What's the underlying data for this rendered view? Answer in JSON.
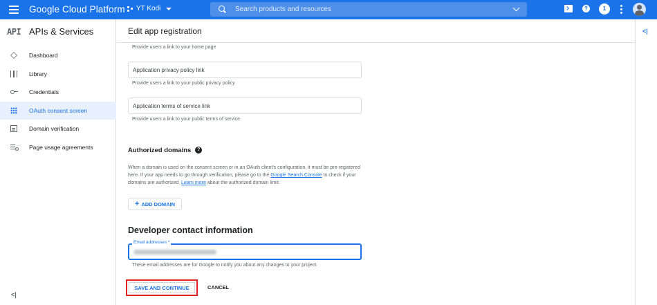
{
  "topbar": {
    "brand": "Google Cloud Platform",
    "project": "YT Kodi",
    "search_placeholder": "Search products and resources",
    "notifications_count": "1"
  },
  "sidebar": {
    "logo": "API",
    "title": "APIs & Services",
    "items": [
      {
        "label": "Dashboard",
        "icon": "dashboard-icon",
        "active": false
      },
      {
        "label": "Library",
        "icon": "library-icon",
        "active": false
      },
      {
        "label": "Credentials",
        "icon": "key-icon",
        "active": false
      },
      {
        "label": "OAuth consent screen",
        "icon": "oauth-icon",
        "active": true
      },
      {
        "label": "Domain verification",
        "icon": "domain-icon",
        "active": false
      },
      {
        "label": "Page usage agreements",
        "icon": "page-usage-icon",
        "active": false
      }
    ],
    "collapse_label": "<|"
  },
  "main": {
    "title": "Edit app registration",
    "homepage_help": "Provide users a link to your home page",
    "privacy_field": {
      "placeholder": "Application privacy policy link",
      "value": ""
    },
    "privacy_help": "Provide users a link to your public privacy policy",
    "terms_field": {
      "placeholder": "Application terms of service link",
      "value": ""
    },
    "terms_help": "Provide users a link to your public terms of service",
    "authorized_domains": {
      "title": "Authorized domains",
      "desc_1": "When a domain is used on the consent screen or in an OAuth client's configuration, it must be pre-registered here. If your app needs to go through verification, please go to the ",
      "link_search_console": "Google Search Console",
      "desc_2": " to check if your domains are authorized. ",
      "link_learn_more": "Learn more",
      "desc_3": " about the authorized domain limit.",
      "add_button": "ADD DOMAIN"
    },
    "developer_contact": {
      "title": "Developer contact information",
      "email_label": "Email addresses *",
      "email_help": "These email addresses are for Google to notify you about any changes to your project."
    },
    "save_button": "SAVE AND CONTINUE",
    "cancel_button": "CANCEL"
  },
  "rail": {
    "toggle_label": "<|"
  },
  "colors": {
    "accent": "#1a73e8",
    "highlight_outline": "#e32424"
  }
}
